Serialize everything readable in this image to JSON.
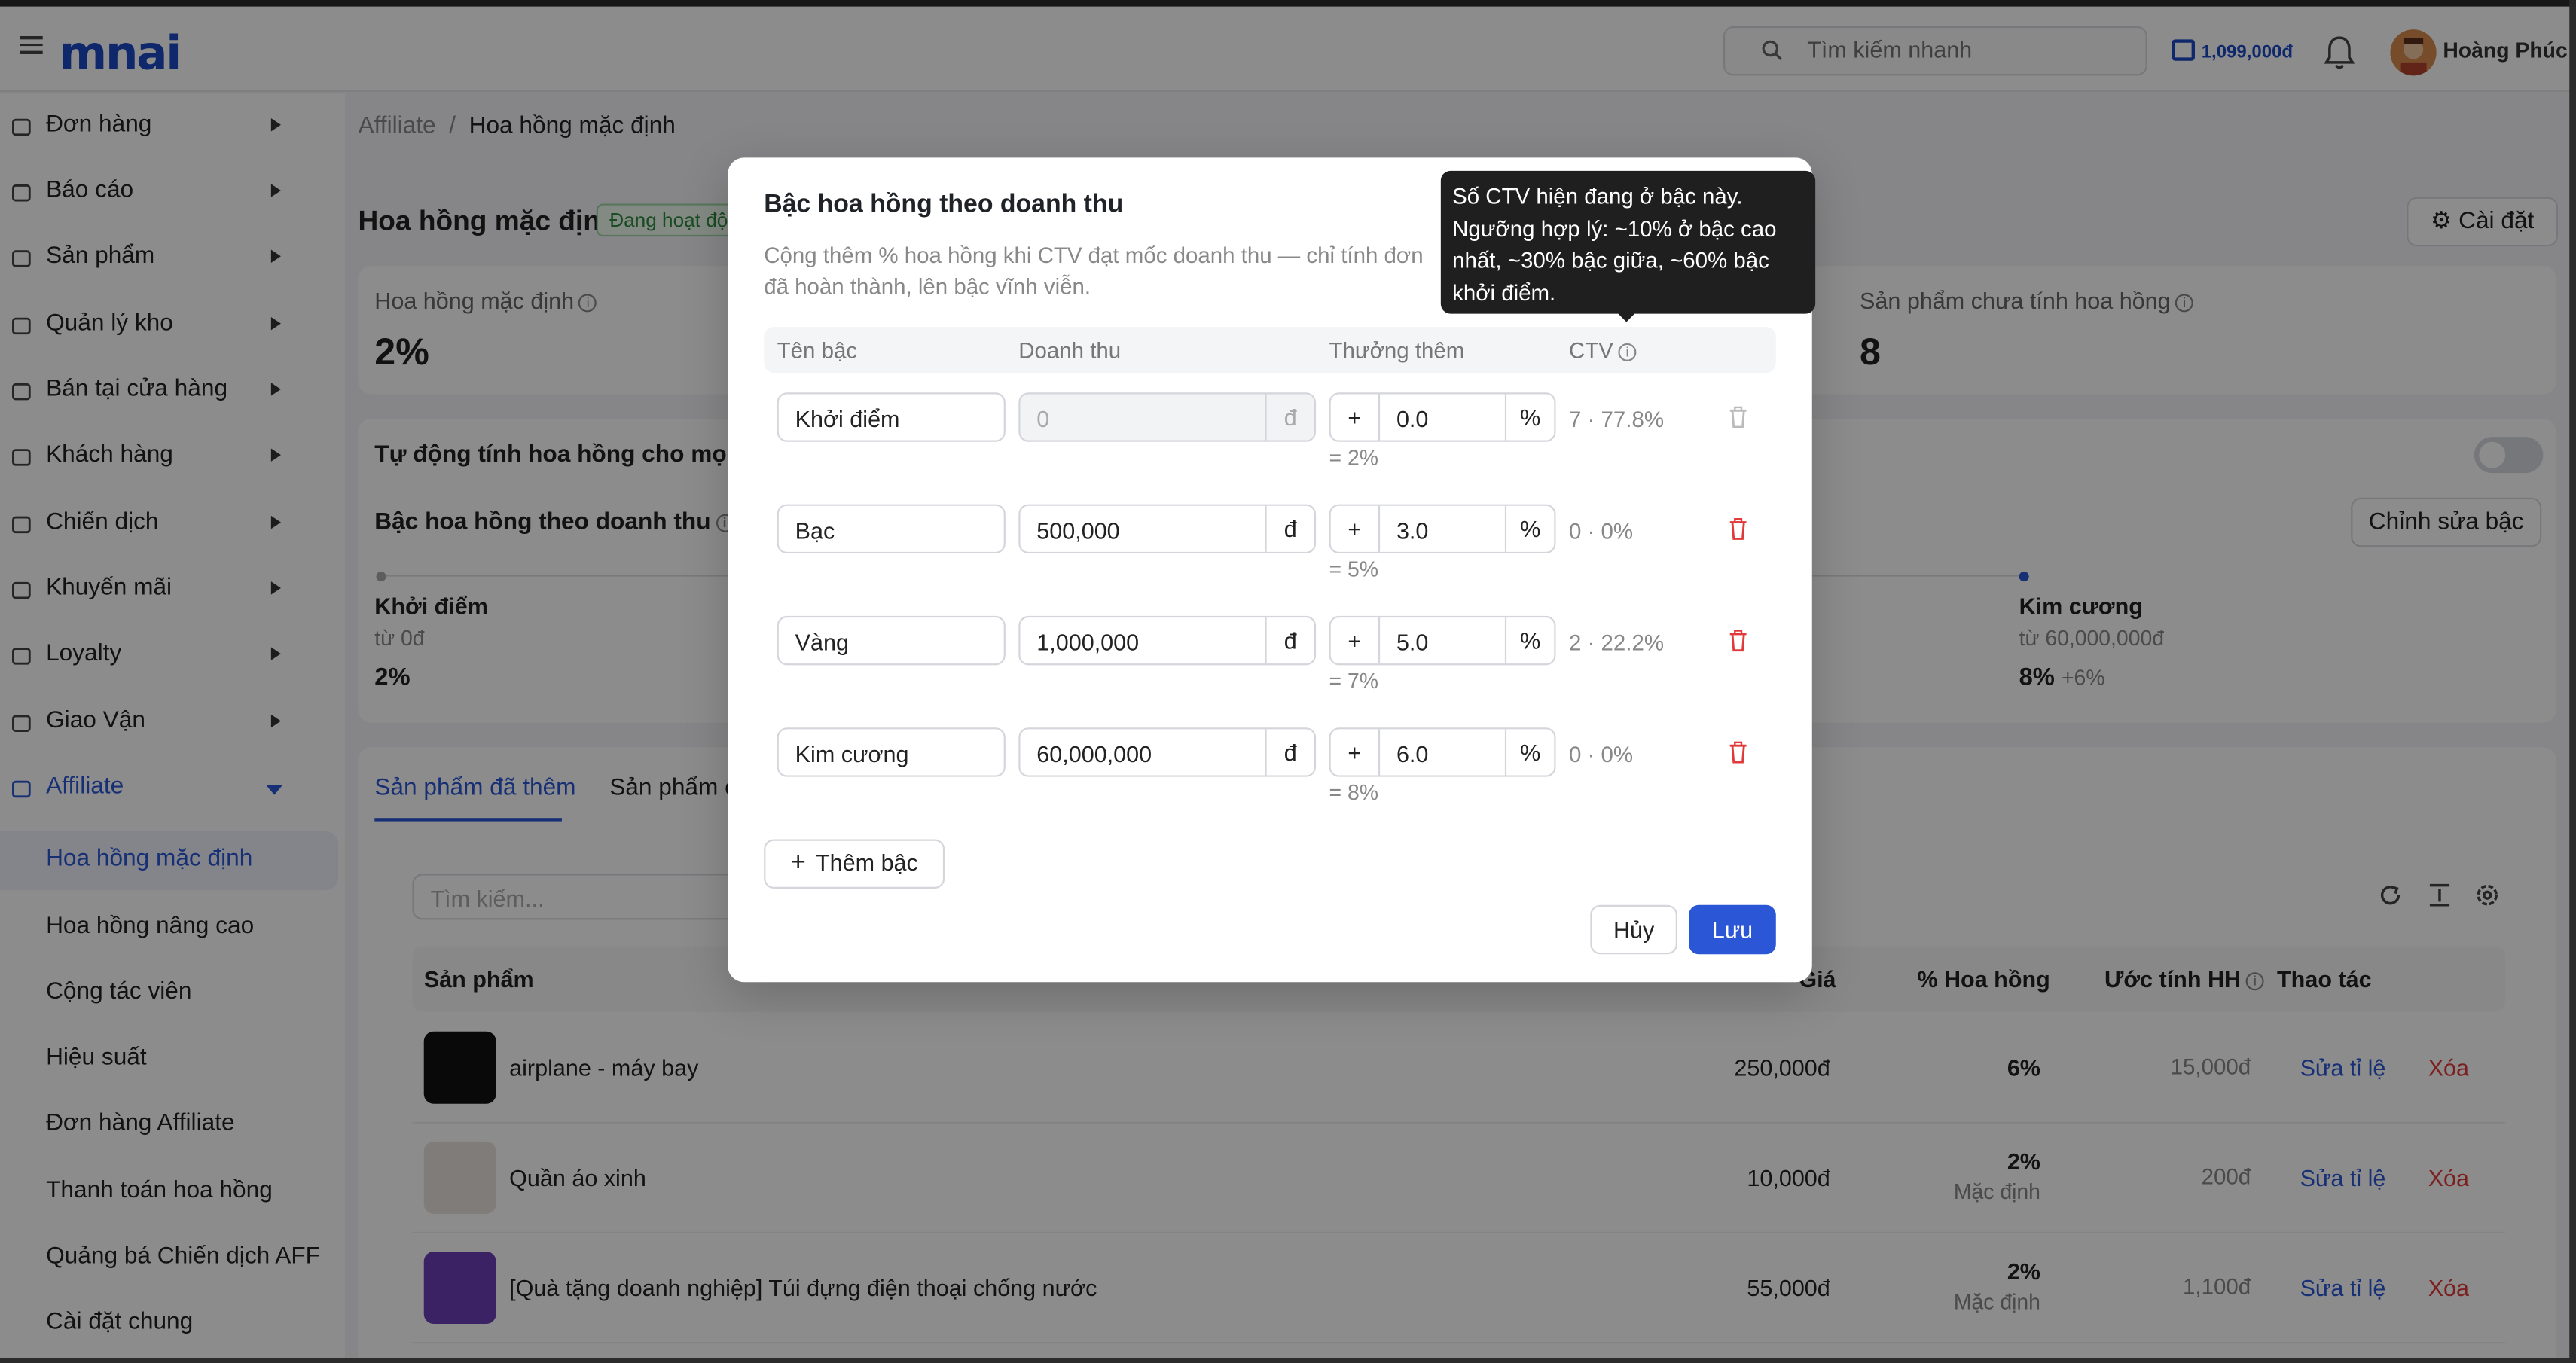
{
  "header": {
    "logo": "mnai",
    "search_placeholder": "Tìm kiếm nhanh",
    "wallet": "1,099,000đ",
    "user": "Hoàng Phúc"
  },
  "sidebar": {
    "items": [
      {
        "label": "Đơn hàng",
        "icon": "bag-icon"
      },
      {
        "label": "Báo cáo",
        "icon": "chart-icon"
      },
      {
        "label": "Sản phẩm",
        "icon": "box-icon"
      },
      {
        "label": "Quản lý kho",
        "icon": "warehouse-icon"
      },
      {
        "label": "Bán tại cửa hàng",
        "icon": "store-icon"
      },
      {
        "label": "Khách hàng",
        "icon": "user-icon"
      },
      {
        "label": "Chiến dịch",
        "icon": "megaphone-icon"
      },
      {
        "label": "Khuyến mãi",
        "icon": "gift-icon"
      },
      {
        "label": "Loyalty",
        "icon": "star-icon"
      },
      {
        "label": "Giao Vận",
        "icon": "truck-icon"
      },
      {
        "label": "Affiliate",
        "icon": "affiliate-icon"
      }
    ],
    "sub_items": [
      "Hoa hồng mặc định",
      "Hoa hồng nâng cao",
      "Cộng tác viên",
      "Hiệu suất",
      "Đơn hàng Affiliate",
      "Thanh toán hoa hồng",
      "Quảng bá Chiến dịch AFF",
      "Cài đặt chung"
    ]
  },
  "main": {
    "breadcrumb": {
      "parent": "Affiliate",
      "sep": "/",
      "current": "Hoa hồng mặc định"
    },
    "title": "Hoa hồng mặc định",
    "status_badge": "Đang hoạt động",
    "settings_label": "Cài đặt",
    "stats": [
      {
        "label": "Hoa hồng mặc định",
        "value": "2%"
      },
      {
        "label": "Sản phẩm chưa tính hoa hồng",
        "value": "8"
      }
    ],
    "auto_label": "Tự động tính hoa hồng cho mọi sản phẩm",
    "tier_title": "Bậc hoa hồng theo doanh thu",
    "edit_tier_label": "Chỉnh sửa bậc",
    "tiers": [
      {
        "name": "Khởi điểm",
        "from": "từ 0đ",
        "pct": "2%",
        "extra": ""
      },
      {
        "name": "Kim cương",
        "from": "từ 60,000,000đ",
        "pct": "8%",
        "extra": "+6%"
      }
    ],
    "tabs": [
      "Sản phẩm đã thêm",
      "Sản phẩm chưa thêm"
    ],
    "table_search_placeholder": "Tìm kiếm...",
    "columns": [
      "Sản phẩm",
      "Giá",
      "% Hoa hồng",
      "Ước tính HH",
      "Thao tác"
    ],
    "rows": [
      {
        "name": "airplane - máy bay",
        "price": "250,000đ",
        "pct": "6%",
        "pct_sub": "",
        "est": "15,000đ",
        "edit": "Sửa tỉ lệ",
        "del": "Xóa"
      },
      {
        "name": "Quần áo xinh",
        "price": "10,000đ",
        "pct": "2%",
        "pct_sub": "Mặc định",
        "est": "200đ",
        "edit": "Sửa tỉ lệ",
        "del": "Xóa"
      },
      {
        "name": "[Quà tặng doanh nghiệp] Túi đựng điện thoại chống nước",
        "price": "55,000đ",
        "pct": "2%",
        "pct_sub": "Mặc định",
        "est": "1,100đ",
        "edit": "Sửa tỉ lệ",
        "del": "Xóa"
      }
    ]
  },
  "modal": {
    "title": "Bậc hoa hồng theo doanh thu",
    "description": "Cộng thêm % hoa hồng khi CTV đạt mốc doanh thu — chỉ tính đơn đã hoàn thành, lên bậc vĩnh viễn.",
    "columns": [
      "Tên bậc",
      "Doanh thu",
      "Thưởng thêm",
      "CTV"
    ],
    "currency": "đ",
    "plus": "+",
    "percent": "%",
    "rows": [
      {
        "name": "Khởi điểm",
        "revenue": "0",
        "bonus": "0.0",
        "total": "= 2%",
        "ctv": "7 · 77.8%"
      },
      {
        "name": "Bạc",
        "revenue": "500,000",
        "bonus": "3.0",
        "total": "= 5%",
        "ctv": "0 · 0%"
      },
      {
        "name": "Vàng",
        "revenue": "1,000,000",
        "bonus": "5.0",
        "total": "= 7%",
        "ctv": "2 · 22.2%"
      },
      {
        "name": "Kim cương",
        "revenue": "60,000,000",
        "bonus": "6.0",
        "total": "= 8%",
        "ctv": "0 · 0%"
      }
    ],
    "add_label": "Thêm bậc",
    "cancel_label": "Hủy",
    "save_label": "Lưu",
    "tooltip": "Số CTV hiện đang ở bậc này. Ngưỡng hợp lý: ~10% ở bậc cao nhất, ~30% bậc giữa, ~60% bậc khởi điểm."
  }
}
